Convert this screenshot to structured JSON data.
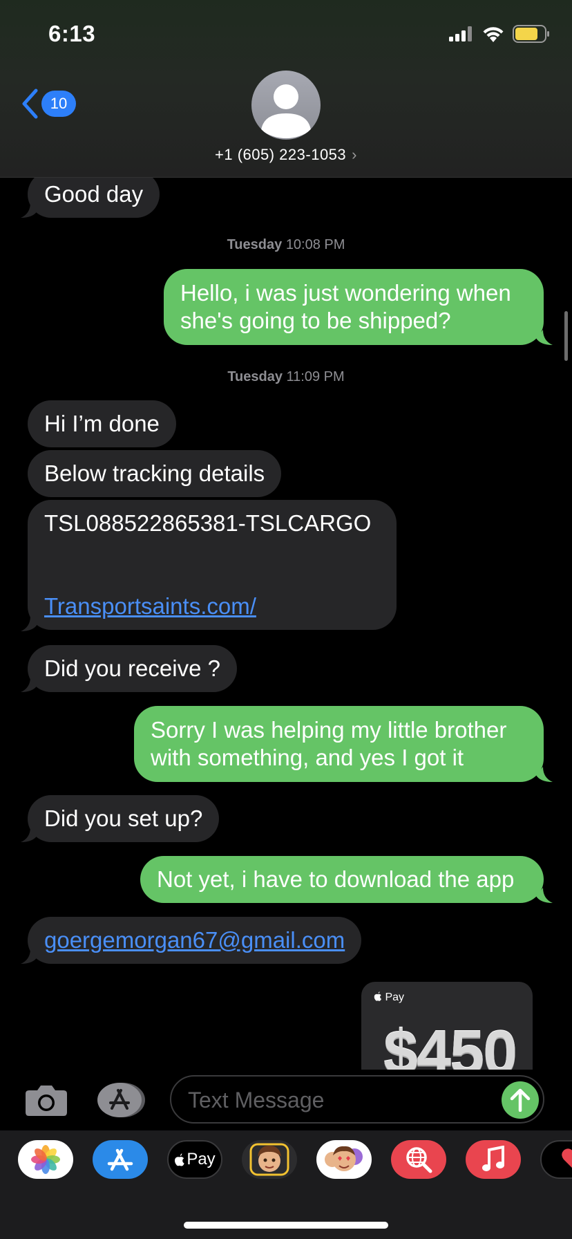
{
  "status_bar": {
    "time": "6:13"
  },
  "header": {
    "back_count": "10",
    "contact": "+1 (605) 223-1053",
    "chevron": "›"
  },
  "messages": {
    "m0": "Good day",
    "ts1": {
      "day": "Tuesday",
      "time": "10:08 PM"
    },
    "m1_line1": "Hello, i was just wondering when",
    "m1_line2": "she's going to be shipped?",
    "ts2": {
      "day": "Tuesday",
      "time": "11:09 PM"
    },
    "m2": "Hi I’m done",
    "m3": "Below tracking details",
    "m4_code": "TSL088522865381-TSLCARGO",
    "m4_link": "Transportsaints.com/",
    "m5": "Did you receive ?",
    "m6_line1": "Sorry I was helping my little brother",
    "m6_line2": "with something, and yes I got it",
    "m7": "Did you set up?",
    "m8": "Not yet, i have to download the app",
    "m9_link": "goergemorgan67@gmail.com",
    "pay": {
      "label": "Pay",
      "amount": "$450"
    }
  },
  "input": {
    "placeholder": "Text Message"
  },
  "drawer": {
    "apple_pay_label": "Pay"
  },
  "colors": {
    "outgoing": "#65c466",
    "incoming": "#262628",
    "link": "#4a8ff7",
    "badge": "#2d7ff9"
  }
}
